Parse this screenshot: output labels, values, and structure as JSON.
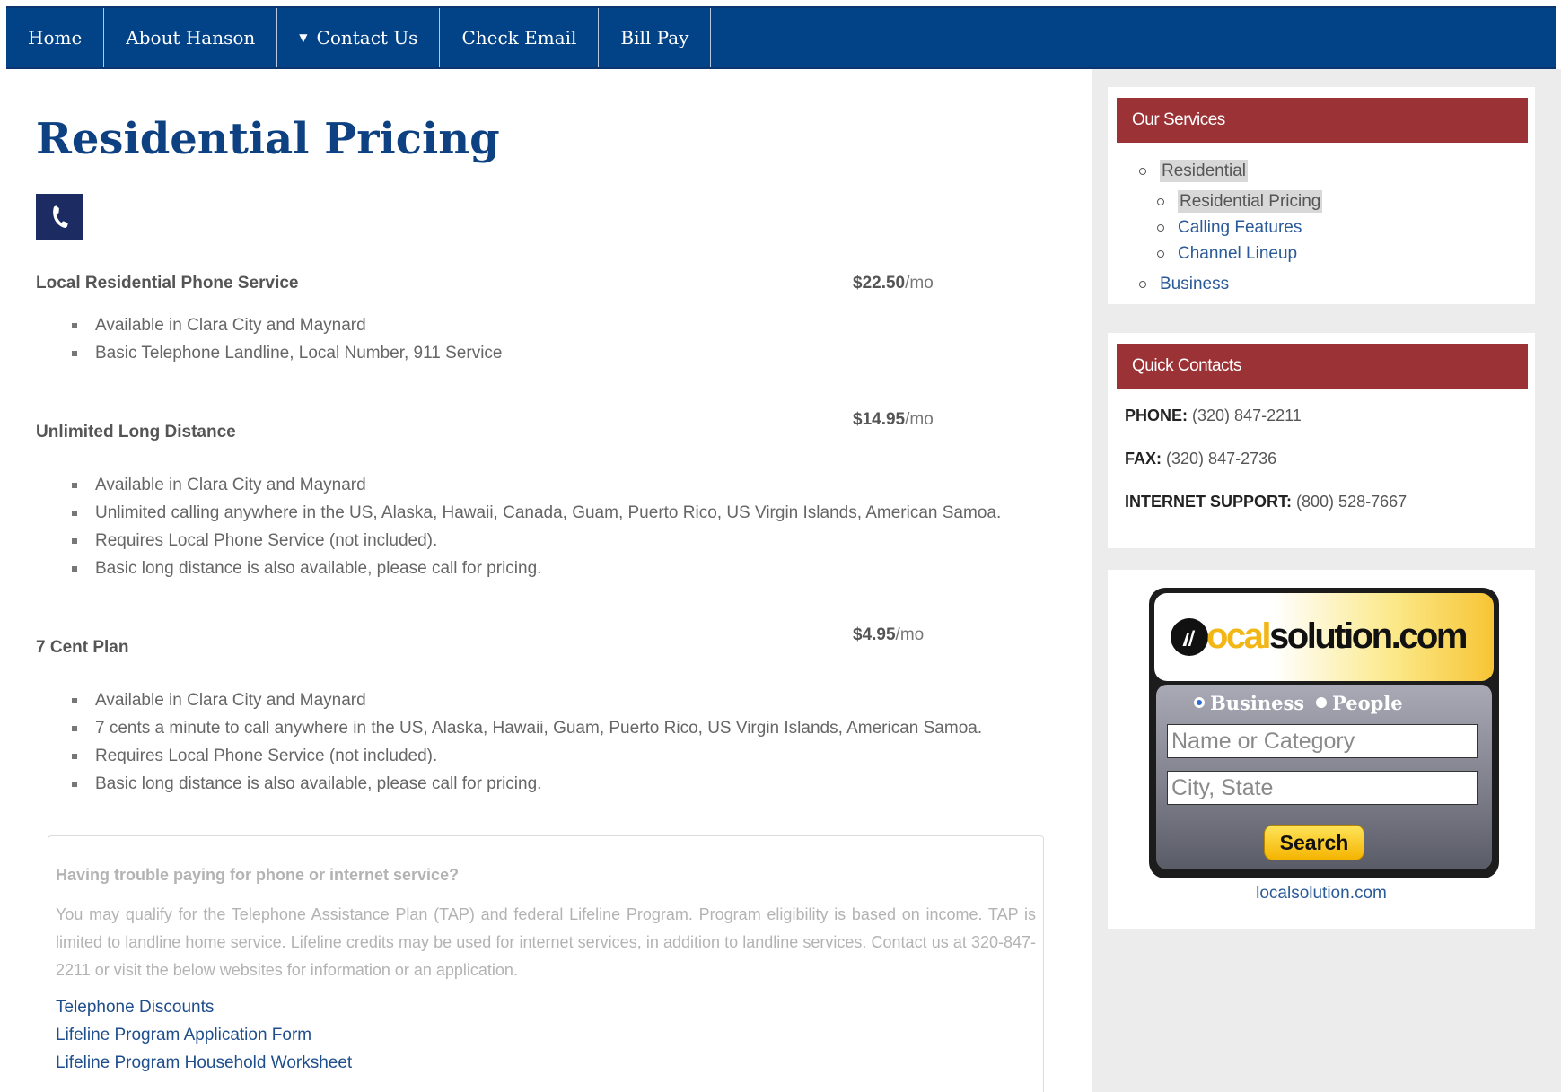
{
  "nav": {
    "items": [
      {
        "label": "Home"
      },
      {
        "label": "About Hanson"
      },
      {
        "label": "Contact Us",
        "caret": "▼"
      },
      {
        "label": "Check Email"
      },
      {
        "label": "Bill Pay"
      }
    ]
  },
  "page": {
    "title": "Residential Pricing"
  },
  "services": [
    {
      "name": "Local Residential Phone Service",
      "price": "$22.50",
      "unit": "/mo",
      "bullets": [
        "Available in Clara City and Maynard",
        "Basic Telephone Landline, Local Number, 911 Service"
      ]
    },
    {
      "name": "Unlimited Long Distance",
      "price": "$14.95",
      "unit": "/mo",
      "bullets": [
        "Available in Clara City and Maynard",
        "Unlimited calling anywhere in the US, Alaska, Hawaii, Canada, Guam, Puerto Rico, US Virgin Islands, American Samoa.",
        "Requires Local Phone Service (not included).",
        "Basic long distance is also available, please call for pricing."
      ]
    },
    {
      "name": "7 Cent Plan",
      "price": "$4.95",
      "unit": "/mo",
      "bullets": [
        "Available in Clara City and Maynard",
        "7 cents a minute to call anywhere in the US, Alaska, Hawaii, Guam, Puerto Rico, US Virgin Islands, American Samoa.",
        "Requires Local Phone Service (not included).",
        "Basic long distance is also available, please call for pricing."
      ]
    }
  ],
  "help": {
    "question": "Having trouble paying for phone or internet service?",
    "paragraph": "You may qualify for the Telephone Assistance Plan (TAP) and federal Lifeline Program. Program eligibility is based on income. TAP is limited to landline home service. Lifeline credits may be used for internet services, in addition to landline services. Contact us at 320-847-2211 or visit the below websites for information or an application.",
    "links": [
      "Telephone Discounts",
      "Lifeline Program Application Form",
      "Lifeline Program Household Worksheet"
    ]
  },
  "sidebar": {
    "our_services": {
      "heading": "Our Services",
      "items": [
        {
          "label": "Residential",
          "highlight": true
        },
        {
          "label": "Residential Pricing",
          "highlight": true
        },
        {
          "label": "Calling Features"
        },
        {
          "label": "Channel Lineup"
        },
        {
          "label": "Business"
        }
      ]
    },
    "quick_contacts": {
      "heading": "Quick Contacts",
      "phone_label": "PHONE:",
      "phone": "(320) 847-2211",
      "fax_label": "FAX:",
      "fax": "(320) 847-2736",
      "support_label": "INTERNET SUPPORT:",
      "support": "(800) 528-7667"
    },
    "localsolution": {
      "logo_prefix": "local",
      "logo_yellow": "ocal",
      "logo_suffix": "solution.com",
      "radio_business": "Business",
      "radio_people": "People",
      "name_placeholder": "Name or Category",
      "city_placeholder": "City, State",
      "search_label": "Search",
      "url": "localsolution.com"
    }
  },
  "colors": {
    "nav_bg": "#024287",
    "title": "#0d4182",
    "widget_head": "#9b3236",
    "link": "#2a5a98"
  }
}
